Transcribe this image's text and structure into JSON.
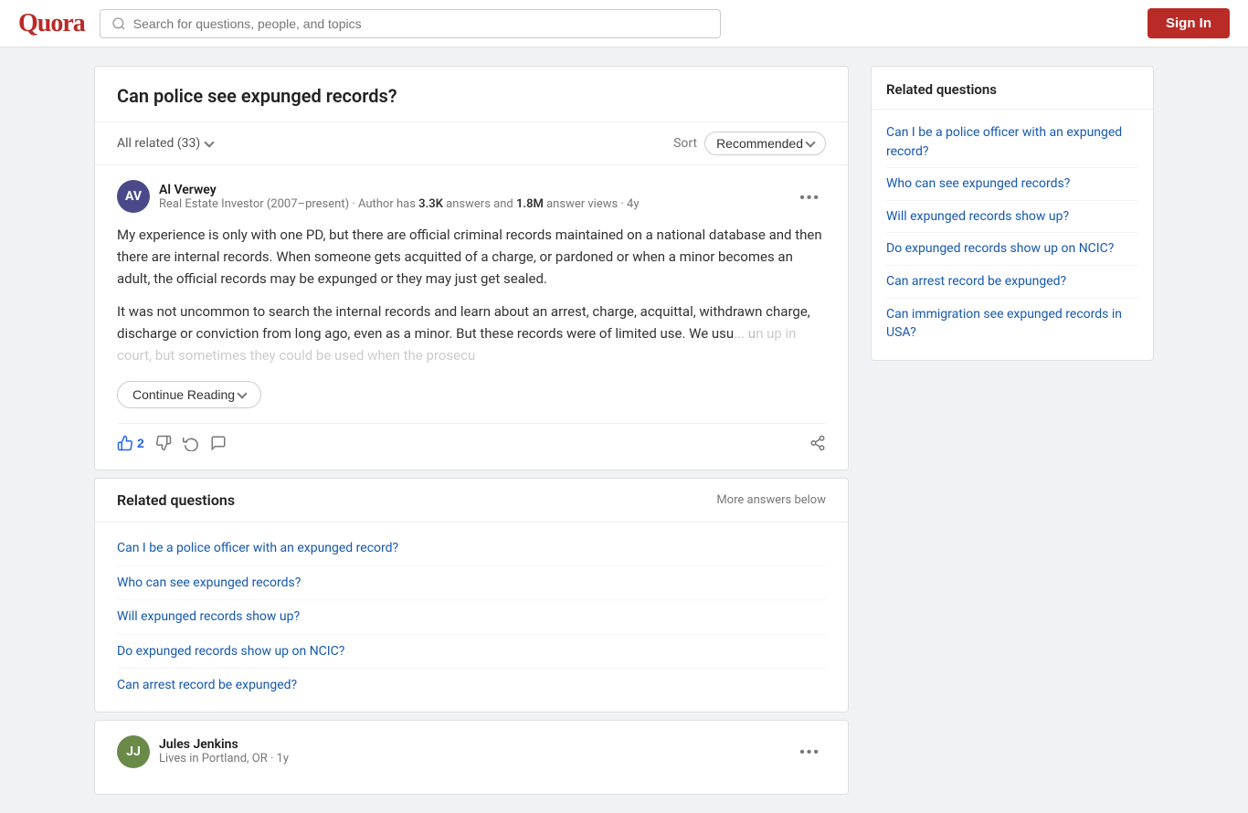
{
  "header": {
    "logo": "Quora",
    "search_placeholder": "Search for questions, people, and topics",
    "sign_in_label": "Sign In"
  },
  "main": {
    "question_title": "Can police see expunged records?",
    "all_related_label": "All related (33)",
    "sort_label": "Sort",
    "sort_value": "Recommended",
    "answer": {
      "author_name": "Al Verwey",
      "author_bio_prefix": "Real Estate Investor (2007–present) · Author has ",
      "author_answers": "3.3K",
      "author_bio_mid": " answers and ",
      "author_views": "1.8M",
      "author_bio_suffix": " answer views · 4y",
      "author_initials": "AV",
      "body_p1": "My experience is only with one PD, but there are official criminal records maintained on a national database and then there are internal records. When someone gets acquitted of a charge, or pardoned or when a minor becomes an adult, the official records may be expunged or they may just get sealed.",
      "body_p2_faded": "It was not uncommon to search the internal records and learn about an arrest, charge, acquittal, withdrawn charge, discharge or conviction from long ago, even as a minor. But these records were of limited use. We usu",
      "body_p2_faded2": "n up in court, but sometimes they could be used when the prosecu",
      "continue_reading_label": "Continue Reading",
      "upvote_count": "2",
      "actions": {
        "upvote": "2",
        "comment": "",
        "share": ""
      }
    },
    "related_questions": {
      "section_title": "Related questions",
      "more_answers_label": "More answers below",
      "items": [
        "Can I be a police officer with an expunged record?",
        "Who can see expunged records?",
        "Will expunged records show up?",
        "Do expunged records show up on NCIC?",
        "Can arrest record be expunged?"
      ]
    },
    "second_answer": {
      "author_name": "Jules Jenkins",
      "author_bio": "Lives in Portland, OR · 1y",
      "author_initials": "JJ"
    }
  },
  "sidebar": {
    "title": "Related questions",
    "links": [
      "Can I be a police officer with an expunged record?",
      "Who can see expunged records?",
      "Will expunged records show up?",
      "Do expunged records show up on NCIC?",
      "Can arrest record be expunged?",
      "Can immigration see expunged records in USA?"
    ]
  }
}
